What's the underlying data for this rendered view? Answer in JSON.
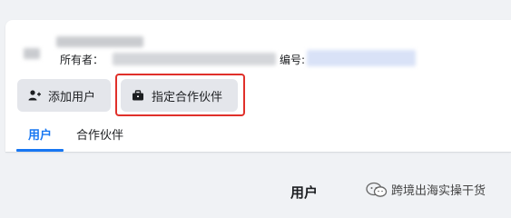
{
  "header": {
    "owner_label": "所有者：",
    "id_label": "编号:"
  },
  "toolbar": {
    "add_user_label": "添加用户",
    "add_user_icon": "person-add-icon",
    "assign_partner_label": "指定合作伙伴",
    "assign_partner_icon": "briefcase-icon"
  },
  "tabs": [
    {
      "label": "用户",
      "active": true
    },
    {
      "label": "合作伙伴",
      "active": false
    }
  ],
  "section": {
    "title": "用户"
  },
  "watermark": {
    "text": "跨境出海实操干货",
    "icon": "wechat-icon"
  },
  "colors": {
    "accent": "#1877f2",
    "highlight": "#e0302a",
    "button_bg": "#e4e6eb"
  }
}
